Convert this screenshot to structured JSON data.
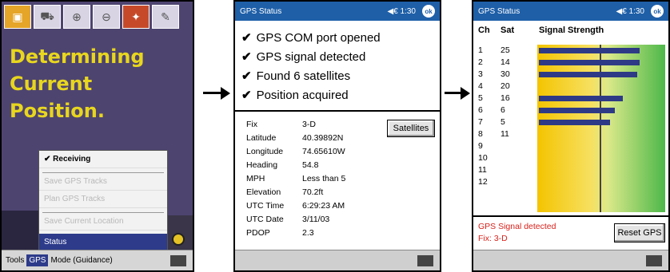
{
  "panel1": {
    "toolbar_icons": [
      "folder-icon",
      "truck-icon",
      "zoom-in-icon",
      "zoom-out-icon",
      "pin-icon",
      "tool-icon"
    ],
    "message_lines": [
      "Determining",
      "Current",
      "Position."
    ],
    "menu": {
      "items": [
        {
          "label": "✔ Receiving",
          "enabled": true
        },
        {
          "label": "Save GPS Tracks",
          "enabled": false
        },
        {
          "label": "Plan GPS Tracks",
          "enabled": false
        },
        {
          "label": "Save Current Location",
          "enabled": false
        },
        {
          "label": "Status",
          "enabled": true,
          "selected": true
        }
      ]
    },
    "bottom_bar": {
      "tools": "Tools",
      "gps": "GPS",
      "mode": "Mode (Guidance)"
    }
  },
  "panel2": {
    "title": "GPS Status",
    "time": "◀€ 1:30",
    "ok_label": "ok",
    "checks": [
      "GPS COM port opened",
      "GPS signal detected",
      "Found 6 satellites",
      "Position acquired"
    ],
    "info_rows": [
      {
        "label": "Fix",
        "value": "3-D"
      },
      {
        "label": "Latitude",
        "value": "40.39892N"
      },
      {
        "label": "Longitude",
        "value": "74.65610W"
      },
      {
        "label": "Heading",
        "value": "54.8"
      },
      {
        "label": "MPH",
        "value": "Less than 5"
      },
      {
        "label": "Elevation",
        "value": "70.2ft"
      },
      {
        "label": "UTC Time",
        "value": "6:29:23 AM"
      },
      {
        "label": "UTC Date",
        "value": "3/11/03"
      },
      {
        "label": "PDOP",
        "value": "2.3"
      }
    ],
    "satellites_button": "Satellites"
  },
  "panel3": {
    "title": "GPS Status",
    "time": "◀€ 1:30",
    "ok_label": "ok",
    "headers": {
      "ch": "Ch",
      "sat": "Sat",
      "signal": "Signal Strength"
    },
    "channels": [
      "1",
      "2",
      "3",
      "4",
      "5",
      "6",
      "7",
      "8",
      "9",
      "10",
      "11",
      "12"
    ],
    "sats": [
      "25",
      "14",
      "30",
      "20",
      "16",
      "6",
      "5",
      "11",
      "",
      "",
      "",
      ""
    ],
    "signal_levels": [
      0.82,
      0.82,
      0.8,
      0,
      0.68,
      0.62,
      0.58,
      0,
      0,
      0,
      0,
      0
    ],
    "status_msg": "GPS Signal detected",
    "fix_line": "Fix: 3-D",
    "reset_button": "Reset GPS"
  }
}
